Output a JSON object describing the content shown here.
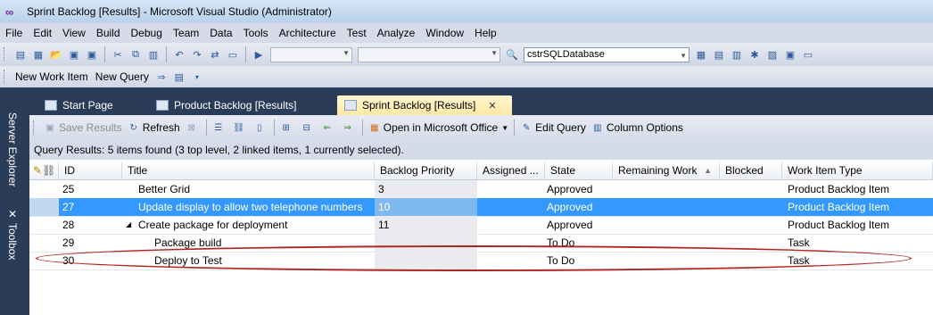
{
  "window": {
    "title": "Sprint Backlog [Results] - Microsoft Visual Studio (Administrator)"
  },
  "menu": [
    "File",
    "Edit",
    "View",
    "Build",
    "Debug",
    "Team",
    "Data",
    "Tools",
    "Architecture",
    "Test",
    "Analyze",
    "Window",
    "Help"
  ],
  "toolbar": {
    "database_combo_value": "cstrSQLDatabase"
  },
  "team_toolbar": {
    "new_work_item": "New Work Item",
    "new_query": "New Query"
  },
  "side_tabs": {
    "server_explorer": "Server Explorer",
    "toolbox": "Toolbox"
  },
  "doc_tabs": [
    {
      "label": "Start Page"
    },
    {
      "label": "Product Backlog [Results]"
    },
    {
      "label": "Sprint Backlog [Results]"
    }
  ],
  "query_toolbar": {
    "save_results": "Save Results",
    "refresh": "Refresh",
    "open_in_office": "Open in Microsoft Office",
    "edit_query": "Edit Query",
    "column_options": "Column Options"
  },
  "query_status": "Query Results: 5 items found (3 top level, 2 linked items, 1 currently selected).",
  "grid": {
    "columns": [
      "ID",
      "Title",
      "Backlog Priority",
      "Assigned ...",
      "State",
      "Remaining Work",
      "Blocked",
      "Work Item Type"
    ],
    "rows": [
      {
        "id": "25",
        "title": "Better Grid",
        "priority": "3",
        "assigned": "",
        "state": "Approved",
        "remaining": "",
        "blocked": "",
        "type": "Product Backlog Item"
      },
      {
        "id": "27",
        "title": "Update display to allow two telephone numbers",
        "priority": "10",
        "assigned": "",
        "state": "Approved",
        "remaining": "",
        "blocked": "",
        "type": "Product Backlog Item"
      },
      {
        "id": "28",
        "title": "Create package for deployment",
        "priority": "11",
        "assigned": "",
        "state": "Approved",
        "remaining": "",
        "blocked": "",
        "type": "Product Backlog Item"
      },
      {
        "id": "29",
        "title": "Package build",
        "priority": "",
        "assigned": "",
        "state": "To Do",
        "remaining": "",
        "blocked": "",
        "type": "Task"
      },
      {
        "id": "30",
        "title": "Deploy to Test",
        "priority": "",
        "assigned": "",
        "state": "To Do",
        "remaining": "",
        "blocked": "",
        "type": "Task"
      }
    ]
  },
  "colors": {
    "selection": "#3399ff",
    "annotation": "#b0241f",
    "chrome_dark": "#2b3c59"
  }
}
